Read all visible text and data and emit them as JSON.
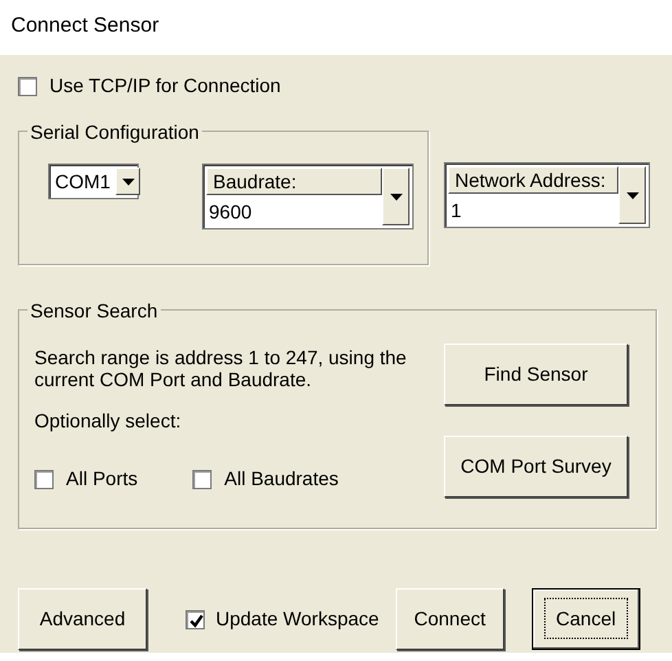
{
  "window": {
    "title": "Connect Sensor"
  },
  "tcp_checkbox": {
    "label": "Use TCP/IP for Connection",
    "checked": false
  },
  "serial_configuration": {
    "title": "Serial Configuration",
    "port": {
      "value": "COM1"
    },
    "baudrate": {
      "label": "Baudrate:",
      "value": "9600"
    }
  },
  "network_address": {
    "label": "Network Address:",
    "value": "1"
  },
  "sensor_search": {
    "title": "Sensor Search",
    "description": "Search range is address 1 to 247, using the current COM Port and Baudrate.",
    "optional_label": "Optionally select:",
    "options": [
      {
        "label": "All Ports",
        "checked": false
      },
      {
        "label": "All Baudrates",
        "checked": false
      }
    ],
    "buttons": [
      {
        "label": "Find Sensor"
      },
      {
        "label": "COM Port Survey"
      }
    ]
  },
  "footer": {
    "advanced_button": "Advanced",
    "update_checkbox": {
      "label": "Update Workspace",
      "checked": true
    },
    "buttons": [
      {
        "label": "Connect",
        "focused": false
      },
      {
        "label": "Cancel",
        "focused": true
      }
    ]
  }
}
